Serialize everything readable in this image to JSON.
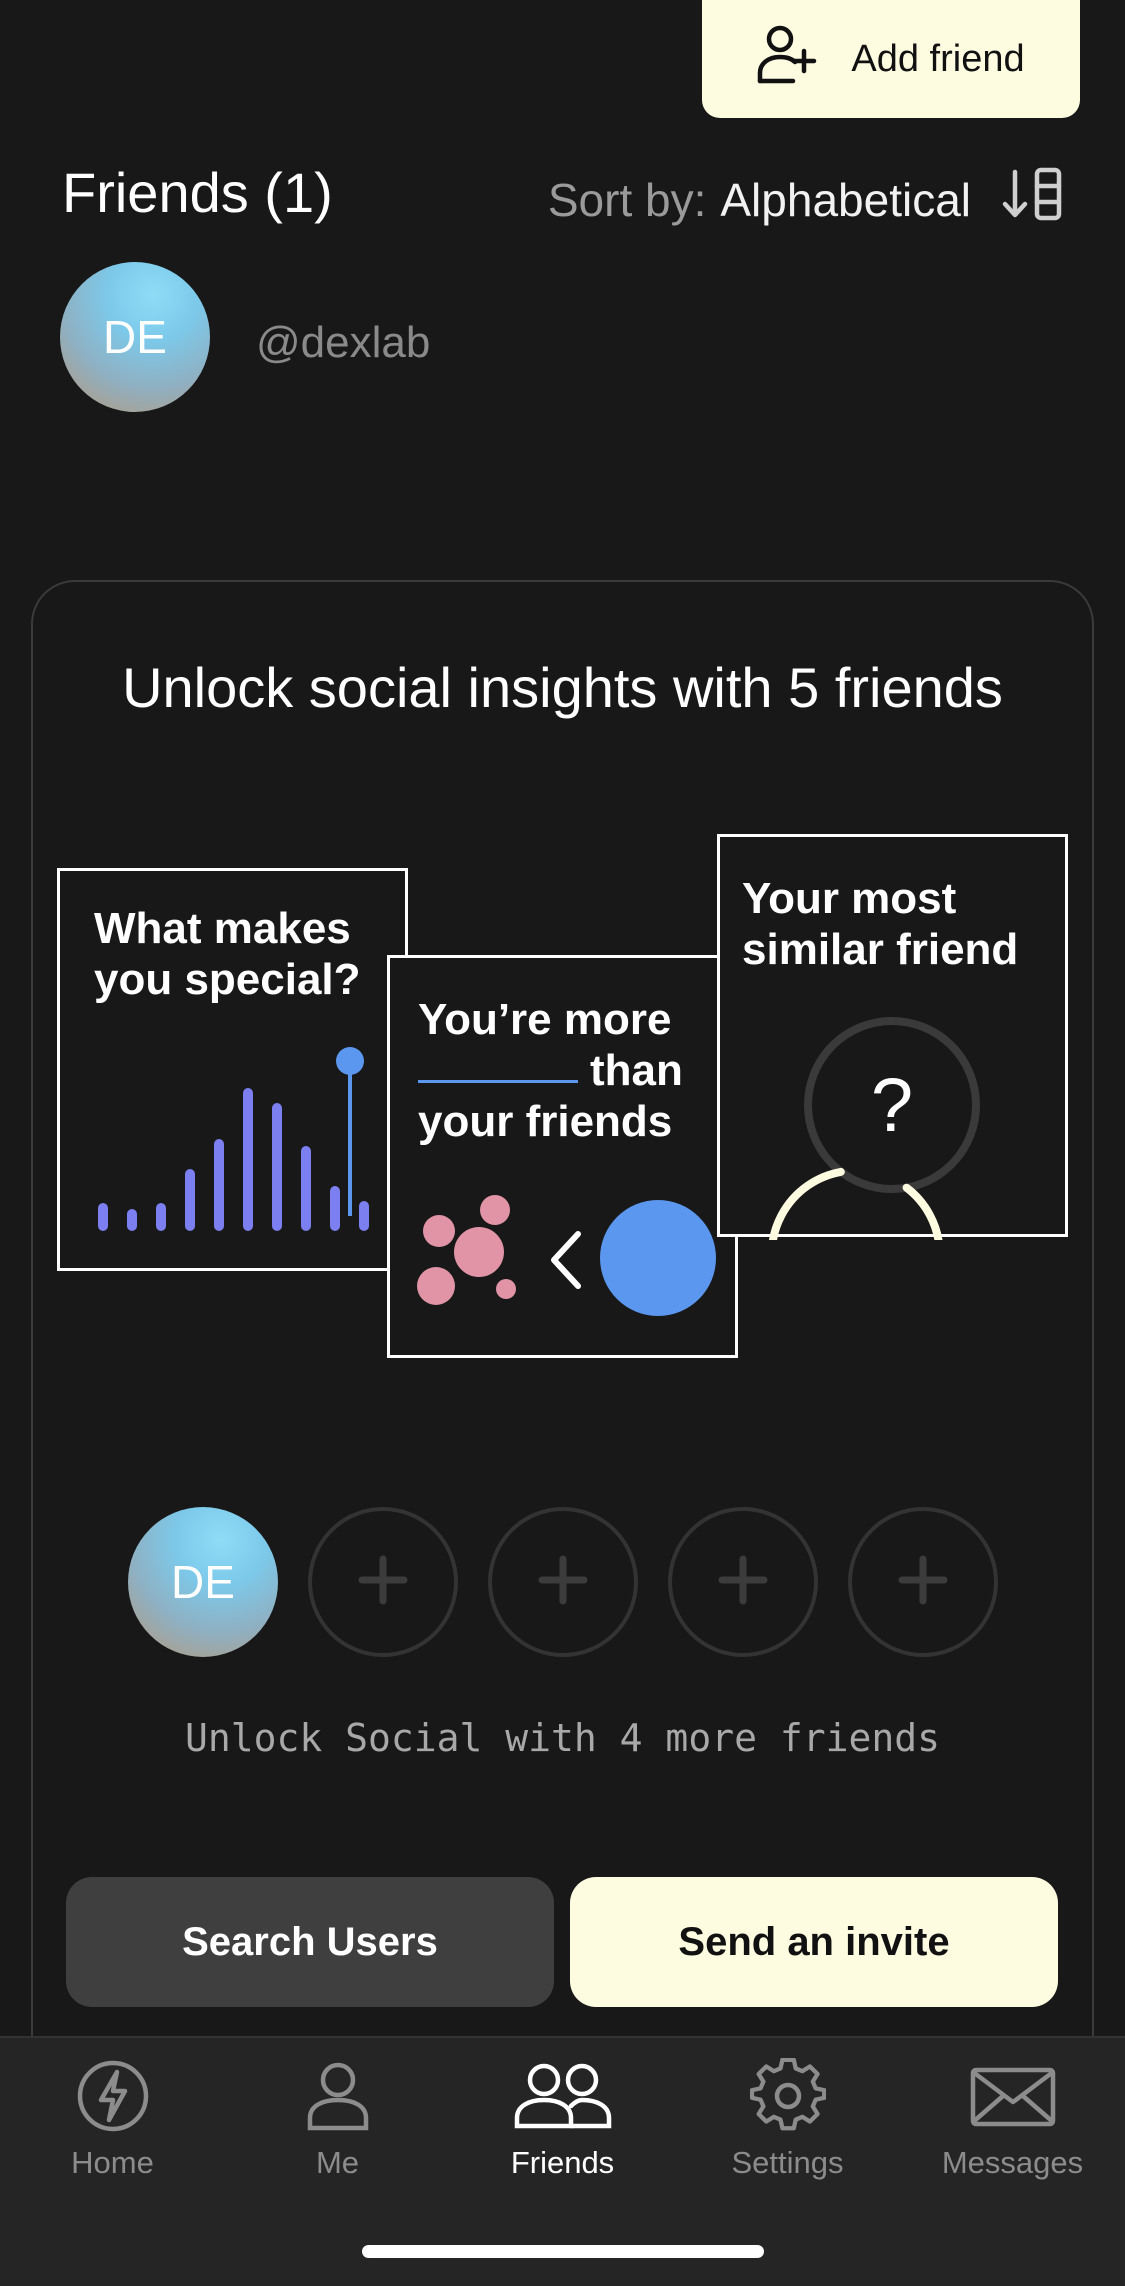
{
  "header": {
    "add_friend_label": "Add friend",
    "friends_title": "Friends (1)",
    "sort_label": "Sort by:",
    "sort_value": "Alphabetical"
  },
  "friends": [
    {
      "initials": "DE",
      "handle": "@dexlab"
    }
  ],
  "insights": {
    "title": "Unlock social insights with 5 friends",
    "panels": {
      "special": {
        "line1": "What makes",
        "line2": "you special?"
      },
      "more": {
        "line1": "You’re more",
        "line2": "than",
        "line3": "your friends"
      },
      "similar": {
        "line1": "Your most",
        "line2": "similar friend",
        "mystery": "?"
      }
    },
    "slots": {
      "filled_initials": "DE",
      "plus": "+"
    },
    "unlock_note": "Unlock Social with 4 more friends",
    "search_button": "Search Users",
    "invite_button": "Send an invite"
  },
  "colors": {
    "background": "#181818",
    "accent_cream": "#fdfbe0",
    "bar_purple": "#7b7ff0",
    "dot_blue": "#5b97ee",
    "bubble_pink": "#e094a6"
  },
  "tabs": [
    {
      "label": "Home",
      "icon": "lightning-icon"
    },
    {
      "label": "Me",
      "icon": "person-icon"
    },
    {
      "label": "Friends",
      "icon": "friends-icon",
      "active": true
    },
    {
      "label": "Settings",
      "icon": "gear-icon"
    },
    {
      "label": "Messages",
      "icon": "envelope-icon"
    }
  ]
}
